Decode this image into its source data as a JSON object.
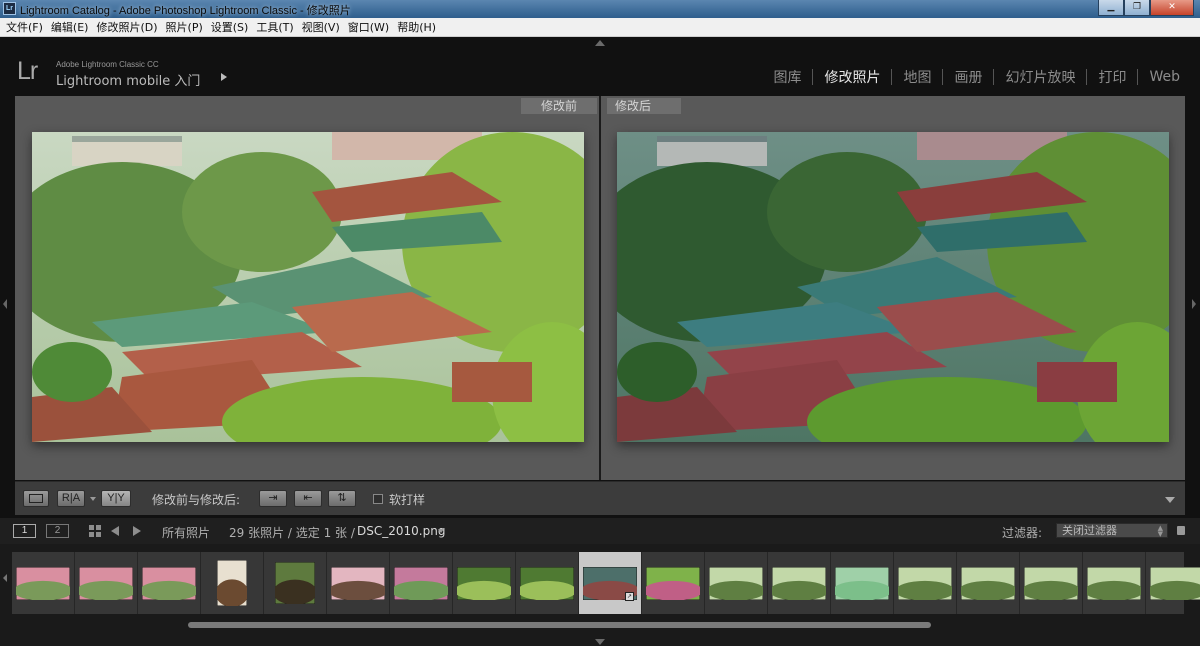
{
  "window": {
    "title": "Lightroom Catalog - Adobe Photoshop Lightroom Classic - 修改照片",
    "icon_text": "Lr",
    "controls": [
      "minimize-icon",
      "maximize-icon",
      "close-icon"
    ]
  },
  "menubar": {
    "items": [
      {
        "label": "文件(F)"
      },
      {
        "label": "编辑(E)"
      },
      {
        "label": "修改照片(D)"
      },
      {
        "label": "照片(P)"
      },
      {
        "label": "设置(S)"
      },
      {
        "label": "工具(T)"
      },
      {
        "label": "视图(V)"
      },
      {
        "label": "窗口(W)"
      },
      {
        "label": "帮助(H)"
      }
    ]
  },
  "identity": {
    "logo": "Lr",
    "product": "Adobe Lightroom Classic CC",
    "mobile": "Lightroom mobile 入门"
  },
  "modules": [
    {
      "label": "图库",
      "active": false
    },
    {
      "label": "修改照片",
      "active": true
    },
    {
      "label": "地图",
      "active": false
    },
    {
      "label": "画册",
      "active": false
    },
    {
      "label": "幻灯片放映",
      "active": false
    },
    {
      "label": "打印",
      "active": false
    },
    {
      "label": "Web",
      "active": false
    }
  ],
  "compare": {
    "before_label": "修改前",
    "after_label": "修改后"
  },
  "toolbar": {
    "view_loupe_icon": "loupe-view-icon",
    "ra_label": "R|A",
    "yy_label": "Y|Y",
    "swap_label": "修改前与修改后:",
    "soft_proof_label": "软打样",
    "soft_proof_checked": false
  },
  "filmstrip_header": {
    "monitor1": "1",
    "monitor2": "2",
    "source": "所有照片",
    "count": "29 张照片 / 选定 1 张 /",
    "filename": "DSC_2010.png",
    "filter_label": "过滤器:",
    "filter_value": "关闭过滤器"
  },
  "filmstrip": {
    "selected_index": 9,
    "thumbs": [
      {
        "tone": "pink-flower",
        "orientation": "landscape"
      },
      {
        "tone": "pink-flower",
        "orientation": "landscape"
      },
      {
        "tone": "pink-flower",
        "orientation": "landscape"
      },
      {
        "tone": "portrait-woman",
        "orientation": "portrait"
      },
      {
        "tone": "portrait-man",
        "orientation": "square"
      },
      {
        "tone": "pink-girl",
        "orientation": "landscape"
      },
      {
        "tone": "pink-field",
        "orientation": "landscape"
      },
      {
        "tone": "green-forest",
        "orientation": "landscape"
      },
      {
        "tone": "green-forest",
        "orientation": "landscape"
      },
      {
        "tone": "temple",
        "orientation": "landscape"
      },
      {
        "tone": "green-flower",
        "orientation": "landscape"
      },
      {
        "tone": "green-lake",
        "orientation": "landscape"
      },
      {
        "tone": "green-lake",
        "orientation": "landscape"
      },
      {
        "tone": "mint",
        "orientation": "landscape"
      },
      {
        "tone": "green-lake",
        "orientation": "landscape"
      },
      {
        "tone": "green-lake",
        "orientation": "landscape"
      },
      {
        "tone": "green-lake",
        "orientation": "landscape"
      },
      {
        "tone": "green-lake",
        "orientation": "landscape"
      },
      {
        "tone": "green-lake",
        "orientation": "landscape"
      }
    ]
  },
  "colors": {
    "app_bg": "#111111",
    "compare_bg": "#595959",
    "active_module": "#e6e6e6",
    "inactive_module": "#8c8c8c"
  }
}
